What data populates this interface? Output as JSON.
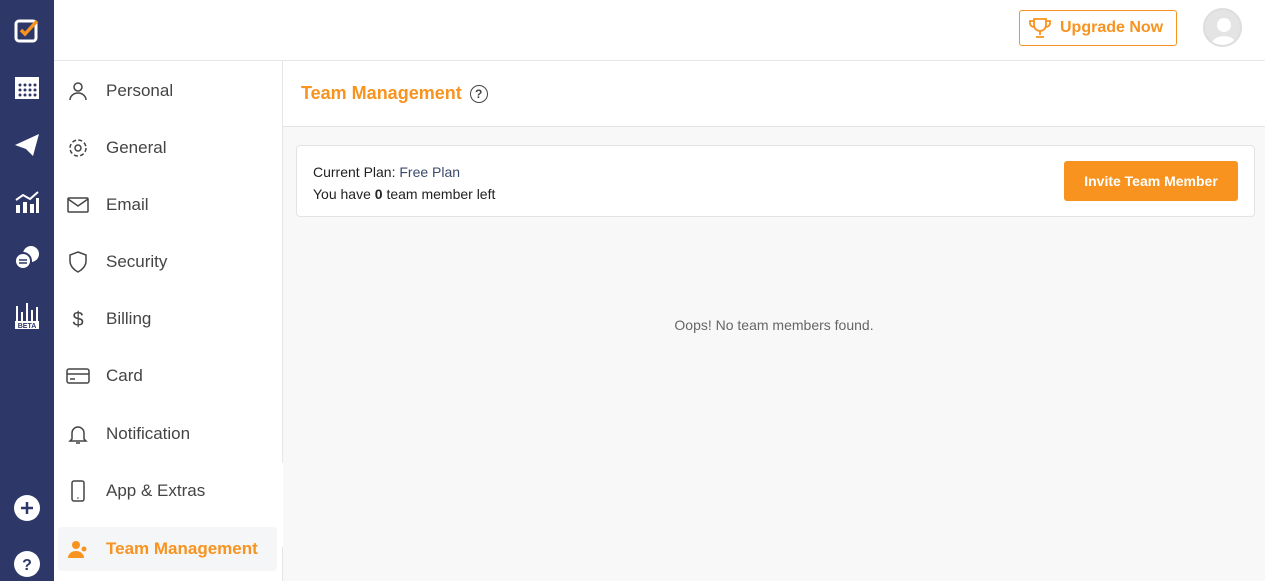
{
  "rail": {
    "items": [
      {
        "icon": "tasks-icon"
      },
      {
        "icon": "calendar-icon"
      },
      {
        "icon": "send-icon"
      },
      {
        "icon": "analytics-icon"
      },
      {
        "icon": "chat-icon"
      },
      {
        "icon": "beta-reports-icon",
        "badge": "BETA"
      },
      {
        "icon": "add-icon"
      },
      {
        "icon": "help-icon"
      }
    ]
  },
  "topbar": {
    "upgrade_label": "Upgrade Now"
  },
  "menu": {
    "items": [
      {
        "label": "Personal"
      },
      {
        "label": "General"
      },
      {
        "label": "Email"
      },
      {
        "label": "Security"
      },
      {
        "label": "Billing"
      },
      {
        "label": "Card"
      },
      {
        "label": "Notification"
      },
      {
        "label": "App & Extras"
      },
      {
        "label": "Team Management",
        "active": true
      }
    ]
  },
  "page": {
    "title": "Team Management",
    "plan_label": "Current Plan:",
    "plan_value": "Free Plan",
    "members_prefix": "You have",
    "members_count": "0",
    "members_suffix": "team member left",
    "invite_label": "Invite Team Member",
    "empty_text": "Oops! No team members found."
  },
  "colors": {
    "accent": "#f7931e",
    "rail": "#2e3868"
  }
}
